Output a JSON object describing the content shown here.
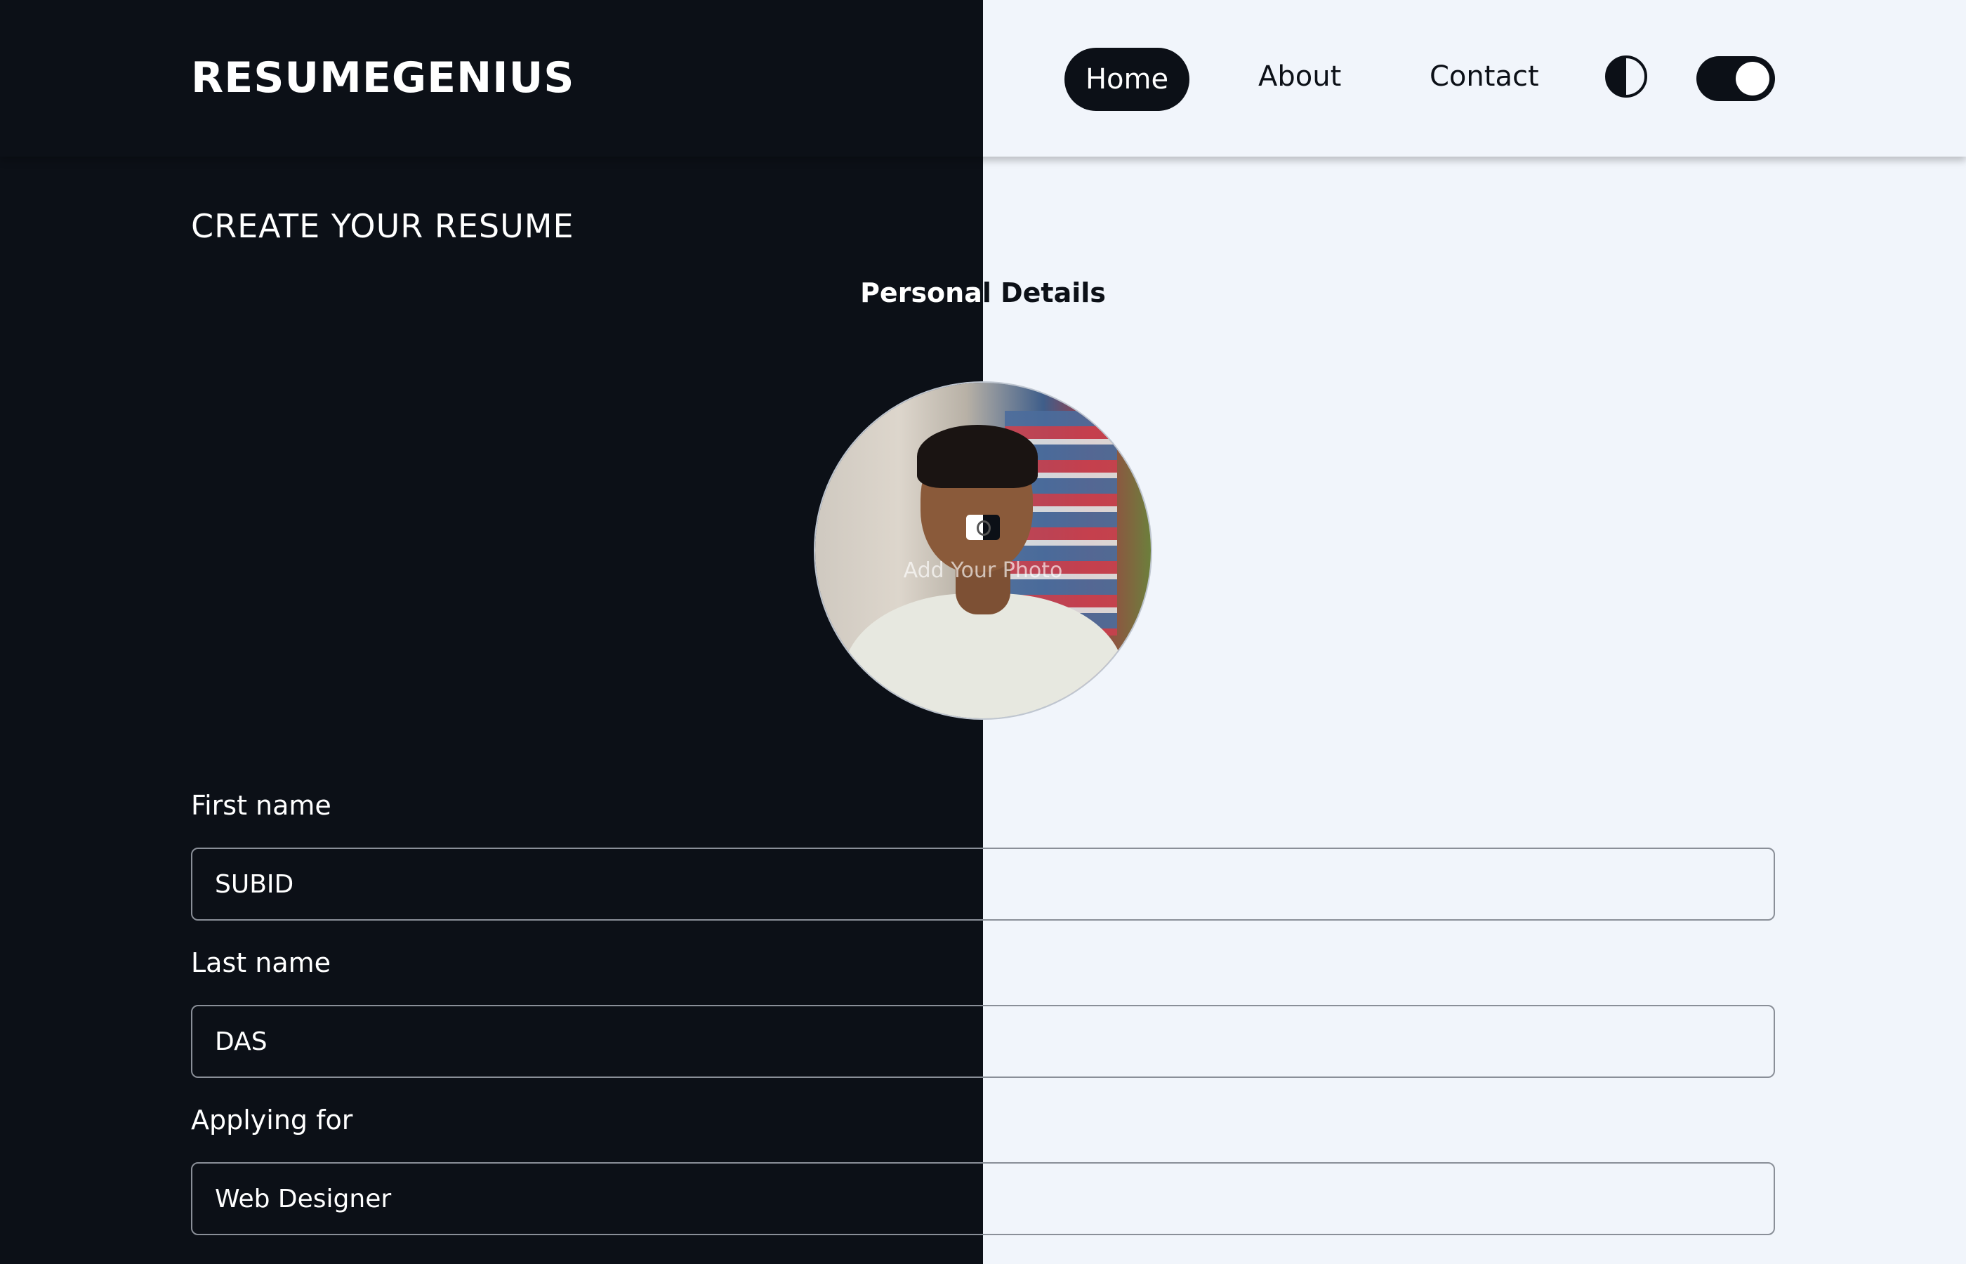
{
  "header": {
    "logo": "RESUMEGENIUS",
    "nav": [
      {
        "label": "Home",
        "active": true
      },
      {
        "label": "About",
        "active": false
      },
      {
        "label": "Contact",
        "active": false
      }
    ],
    "contrast_icon": "contrast-icon",
    "theme_toggle": {
      "state": "on"
    }
  },
  "main": {
    "title": "CREATE YOUR RESUME",
    "section": "Personal Details",
    "photo": {
      "label": "Add Your Photo",
      "icon": "camera-icon"
    },
    "fields": [
      {
        "label": "First name",
        "value": "SUBID"
      },
      {
        "label": "Last name",
        "value": "DAS"
      },
      {
        "label": "Applying for",
        "value": "Web Designer"
      }
    ]
  },
  "colors": {
    "dark": "#0c1017",
    "light": "#f1f5fb",
    "border": "#8a8f98"
  }
}
